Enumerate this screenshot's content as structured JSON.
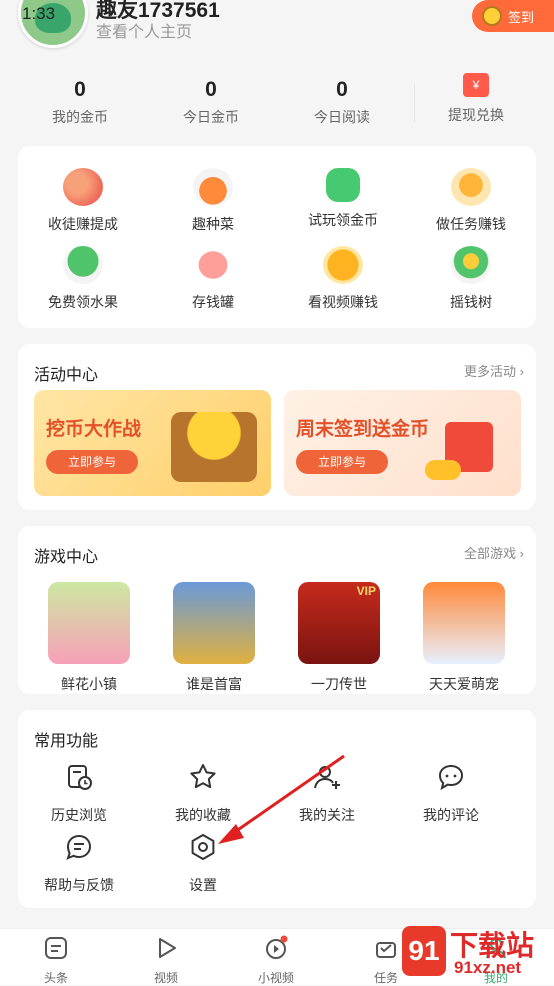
{
  "status": {
    "time": "1:33"
  },
  "profile": {
    "username": "趣友1737561",
    "subtitle": "查看个人主页",
    "checkin_label": "签到"
  },
  "stats": [
    {
      "value": "0",
      "label": "我的金币"
    },
    {
      "value": "0",
      "label": "今日金币"
    },
    {
      "value": "0",
      "label": "今日阅读"
    }
  ],
  "withdraw": {
    "label": "提现兑换",
    "icon_text": "¥"
  },
  "features": [
    {
      "label": "收徒赚提成",
      "icon": "people-icon"
    },
    {
      "label": "趣种菜",
      "icon": "carrot-icon"
    },
    {
      "label": "试玩领金币",
      "icon": "android-icon"
    },
    {
      "label": "做任务赚钱",
      "icon": "coin-hand-icon"
    },
    {
      "label": "免费领水果",
      "icon": "tree-icon"
    },
    {
      "label": "存钱罐",
      "icon": "piggy-bank-icon"
    },
    {
      "label": "看视频赚钱",
      "icon": "play-coin-icon"
    },
    {
      "label": "摇钱树",
      "icon": "money-tree-icon"
    }
  ],
  "activity": {
    "title": "活动中心",
    "more": "更多活动",
    "banners": [
      {
        "title": "挖币大作战",
        "button": "立即参与"
      },
      {
        "title": "周末签到送金币",
        "button": "立即参与"
      }
    ]
  },
  "games": {
    "title": "游戏中心",
    "more": "全部游戏",
    "items": [
      {
        "label": "鲜花小镇"
      },
      {
        "label": "谁是首富"
      },
      {
        "label": "一刀传世",
        "badge": "VIP"
      },
      {
        "label": "天天爱萌宠"
      }
    ]
  },
  "common": {
    "title": "常用功能",
    "items": [
      {
        "label": "历史浏览"
      },
      {
        "label": "我的收藏"
      },
      {
        "label": "我的关注"
      },
      {
        "label": "我的评论"
      },
      {
        "label": "帮助与反馈"
      },
      {
        "label": "设置"
      }
    ]
  },
  "nav": [
    {
      "label": "头条"
    },
    {
      "label": "视频"
    },
    {
      "label": "小视频"
    },
    {
      "label": "任务"
    },
    {
      "label": "我的"
    }
  ],
  "watermark": {
    "text": "下载站",
    "url": "91xz.net"
  },
  "colors": {
    "accent": "#f0643a",
    "red": "#e02020",
    "text": "#333333"
  }
}
